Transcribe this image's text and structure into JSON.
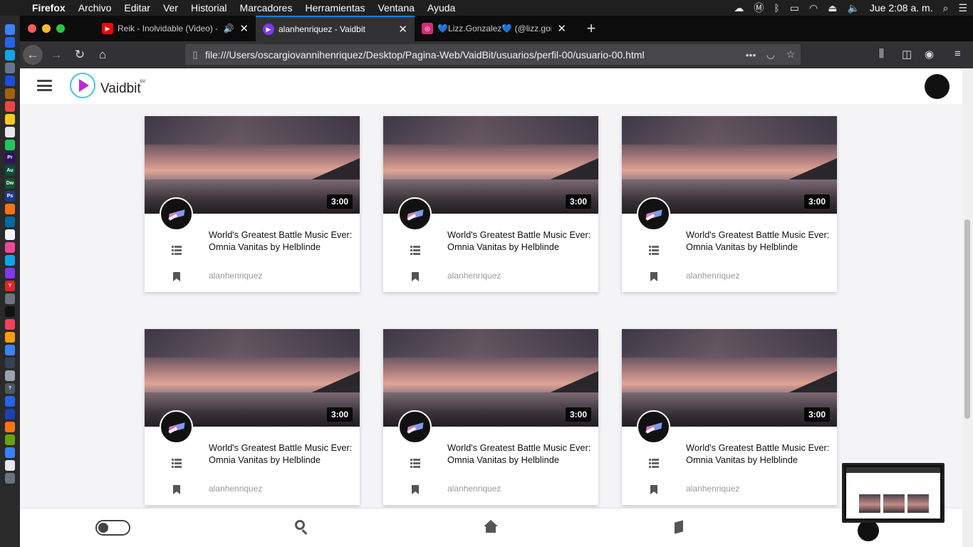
{
  "menubar": {
    "app": "Firefox",
    "items": [
      "Archivo",
      "Editar",
      "Ver",
      "Historial",
      "Marcadores",
      "Herramientas",
      "Ventana",
      "Ayuda"
    ],
    "clock": "Jue 2:08 a. m."
  },
  "browser": {
    "tabs": [
      {
        "title": "Reik - Inolvidable (Video) - ",
        "icon": "youtube-icon"
      },
      {
        "title": "alanhenriquez - Vaidbit",
        "icon": "vaidbit-icon",
        "active": true
      },
      {
        "title": "💙Lizz.Gonzalez💙 (@lizz.gonz",
        "icon": "instagram-icon"
      }
    ],
    "url": "file:///Users/oscargiovannihenriquez/Desktop/Pagina-Web/VaidBit/usuarios/perfil-00/usuario-00.html"
  },
  "site": {
    "brand": "Vaidbit",
    "brand_sup": "sv"
  },
  "videos": [
    {
      "duration": "3:00",
      "title": "World's Greatest Battle Music Ever: Omnia Vanitas by Helblinde",
      "author": "alanhenriquez"
    },
    {
      "duration": "3:00",
      "title": "World's Greatest Battle Music Ever: Omnia Vanitas by Helblinde",
      "author": "alanhenriquez"
    },
    {
      "duration": "3:00",
      "title": "World's Greatest Battle Music Ever: Omnia Vanitas by Helblinde",
      "author": "alanhenriquez"
    },
    {
      "duration": "3:00",
      "title": "World's Greatest Battle Music Ever: Omnia Vanitas by Helblinde",
      "author": "alanhenriquez"
    },
    {
      "duration": "3:00",
      "title": "World's Greatest Battle Music Ever: Omnia Vanitas by Helblinde",
      "author": "alanhenriquez"
    },
    {
      "duration": "3:00",
      "title": "World's Greatest Battle Music Ever: Omnia Vanitas by Helblinde",
      "author": "alanhenriquez"
    }
  ]
}
